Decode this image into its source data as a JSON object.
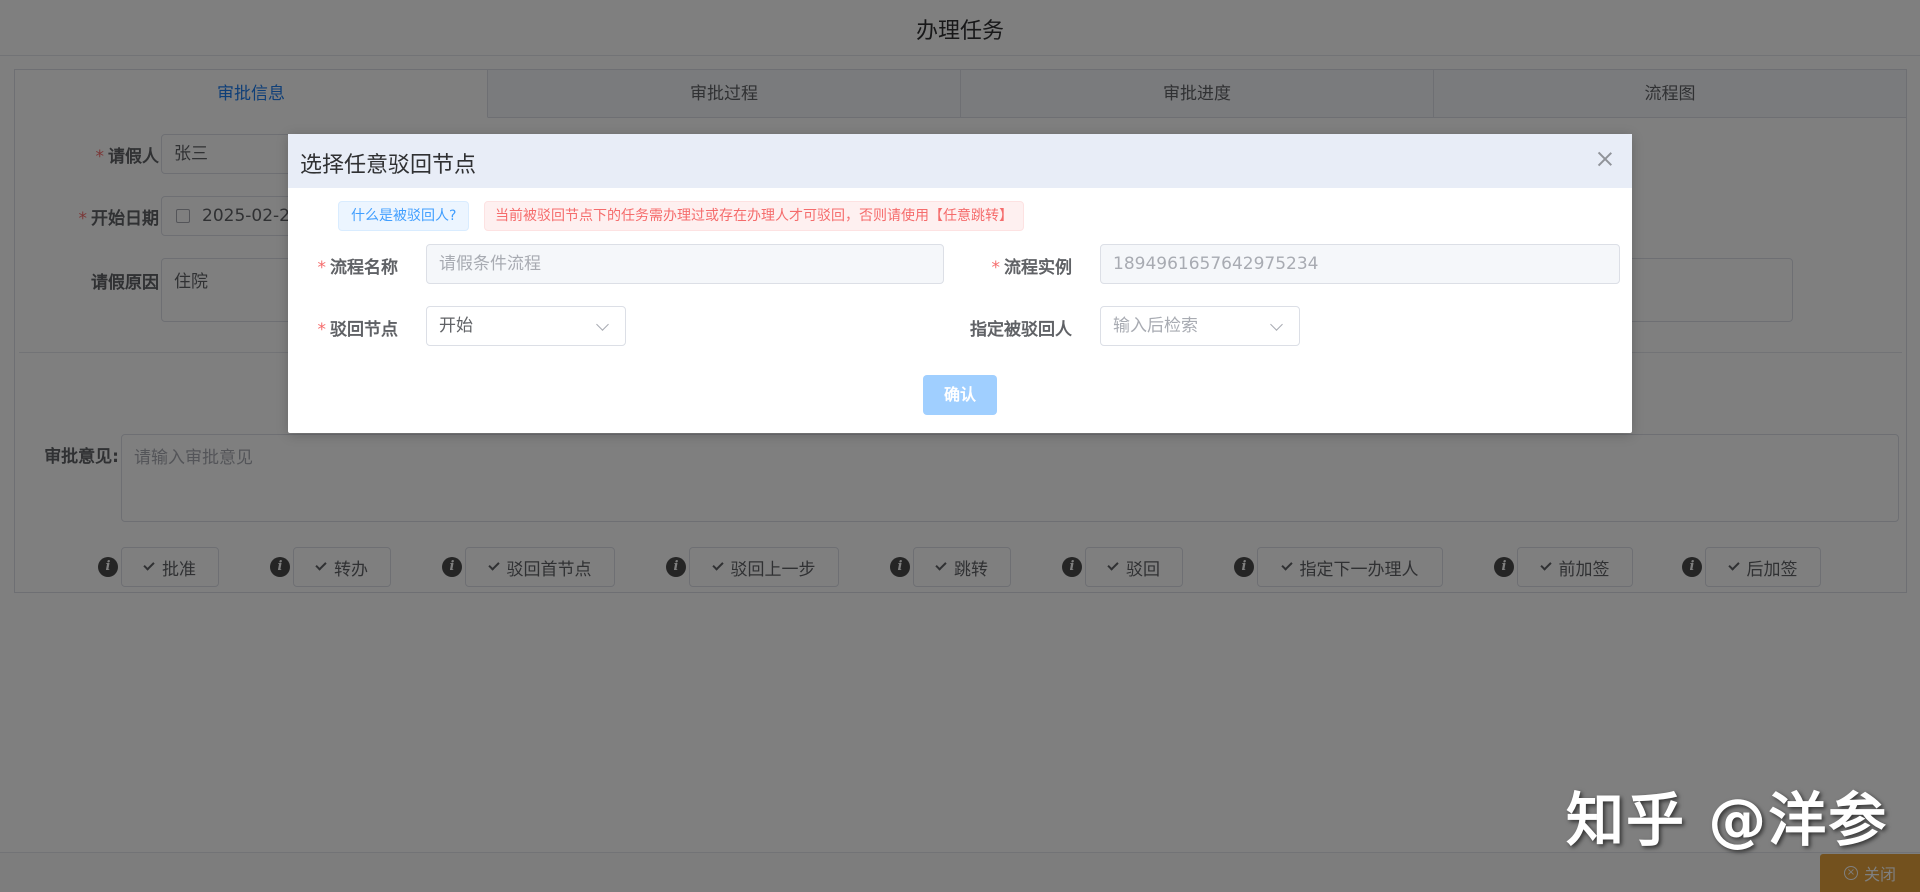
{
  "header": {
    "title": "办理任务"
  },
  "tabs": [
    {
      "label": "审批信息",
      "active": true
    },
    {
      "label": "审批过程",
      "active": false
    },
    {
      "label": "审批进度",
      "active": false
    },
    {
      "label": "流程图",
      "active": false
    }
  ],
  "form": {
    "applicant": {
      "label": "请假人",
      "value": "张三"
    },
    "start_date": {
      "label": "开始日期",
      "value": "2025-02-27"
    },
    "reason": {
      "label": "请假原因",
      "value": "住院"
    },
    "opinion": {
      "label": "审批意见:",
      "placeholder": "请输入审批意见"
    }
  },
  "actions": [
    {
      "label": "批准"
    },
    {
      "label": "转办"
    },
    {
      "label": "驳回首节点"
    },
    {
      "label": "驳回上一步"
    },
    {
      "label": "跳转"
    },
    {
      "label": "驳回"
    },
    {
      "label": "指定下一办理人"
    },
    {
      "label": "前加签"
    },
    {
      "label": "后加签"
    }
  ],
  "footer": {
    "close_label": "关闭"
  },
  "dialog": {
    "title": "选择任意驳回节点",
    "info_tag": "什么是被驳回人?",
    "warning_tag": "当前被驳回节点下的任务需办理过或存在办理人才可驳回，否则请使用【任意跳转】",
    "process_name": {
      "label": "流程名称",
      "placeholder": "请假条件流程"
    },
    "process_instance": {
      "label": "流程实例",
      "value": "1894961657642975234"
    },
    "reject_node": {
      "label": "驳回节点",
      "value": "开始"
    },
    "assignee": {
      "label": "指定被驳回人",
      "placeholder": "输入后检索"
    },
    "confirm_label": "确认"
  },
  "watermark": "知乎 @洋参"
}
